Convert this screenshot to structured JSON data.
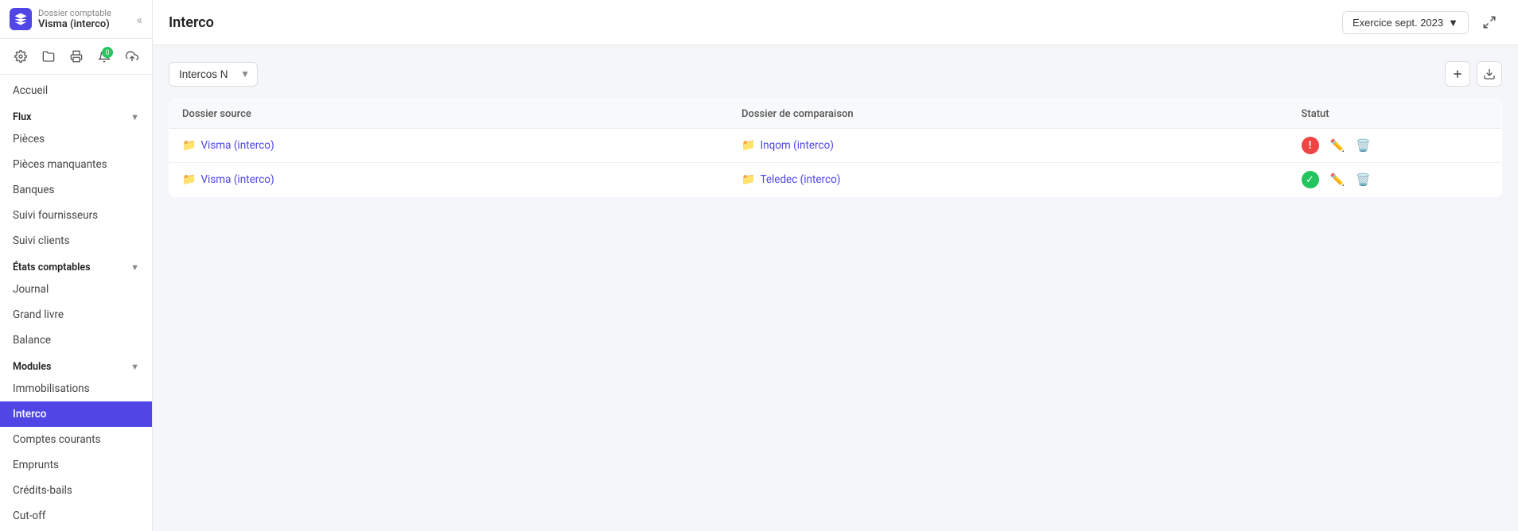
{
  "app": {
    "company_label": "Dossier comptable",
    "company_name": "Visma (interco)",
    "page_title": "Interco",
    "exercise_label": "Exercice sept. 2023"
  },
  "sidebar": {
    "nav_items": [
      {
        "id": "accueil",
        "label": "Accueil",
        "section": null,
        "active": false
      },
      {
        "id": "flux-section",
        "label": "Flux",
        "type": "section"
      },
      {
        "id": "pieces",
        "label": "Pièces",
        "active": false
      },
      {
        "id": "pieces-manquantes",
        "label": "Pièces manquantes",
        "active": false
      },
      {
        "id": "banques",
        "label": "Banques",
        "active": false
      },
      {
        "id": "suivi-fournisseurs",
        "label": "Suivi fournisseurs",
        "active": false
      },
      {
        "id": "suivi-clients",
        "label": "Suivi clients",
        "active": false
      },
      {
        "id": "etats-comptables-section",
        "label": "États comptables",
        "type": "section"
      },
      {
        "id": "journal",
        "label": "Journal",
        "active": false
      },
      {
        "id": "grand-livre",
        "label": "Grand livre",
        "active": false
      },
      {
        "id": "balance",
        "label": "Balance",
        "active": false
      },
      {
        "id": "modules-section",
        "label": "Modules",
        "type": "section"
      },
      {
        "id": "immobilisations",
        "label": "Immobilisations",
        "active": false
      },
      {
        "id": "interco",
        "label": "Interco",
        "active": true
      },
      {
        "id": "comptes-courants",
        "label": "Comptes courants",
        "active": false
      },
      {
        "id": "emprunts",
        "label": "Emprunts",
        "active": false
      },
      {
        "id": "credits-bails",
        "label": "Crédits-bails",
        "active": false
      },
      {
        "id": "cut-off",
        "label": "Cut-off",
        "active": false
      }
    ],
    "toolbar": {
      "badge_count": "0"
    }
  },
  "interco": {
    "select_options": [
      "Intercos N"
    ],
    "select_value": "Intercos N",
    "columns": {
      "dossier_source": "Dossier source",
      "dossier_comparaison": "Dossier de comparaison",
      "statut": "Statut"
    },
    "rows": [
      {
        "source": "Visma (interco)",
        "comparison": "Inqom (interco)",
        "status": "error",
        "status_icon": "!"
      },
      {
        "source": "Visma (interco)",
        "comparison": "Teledec (interco)",
        "status": "ok",
        "status_icon": "✓"
      }
    ],
    "add_button_title": "Ajouter",
    "download_button_title": "Télécharger"
  }
}
